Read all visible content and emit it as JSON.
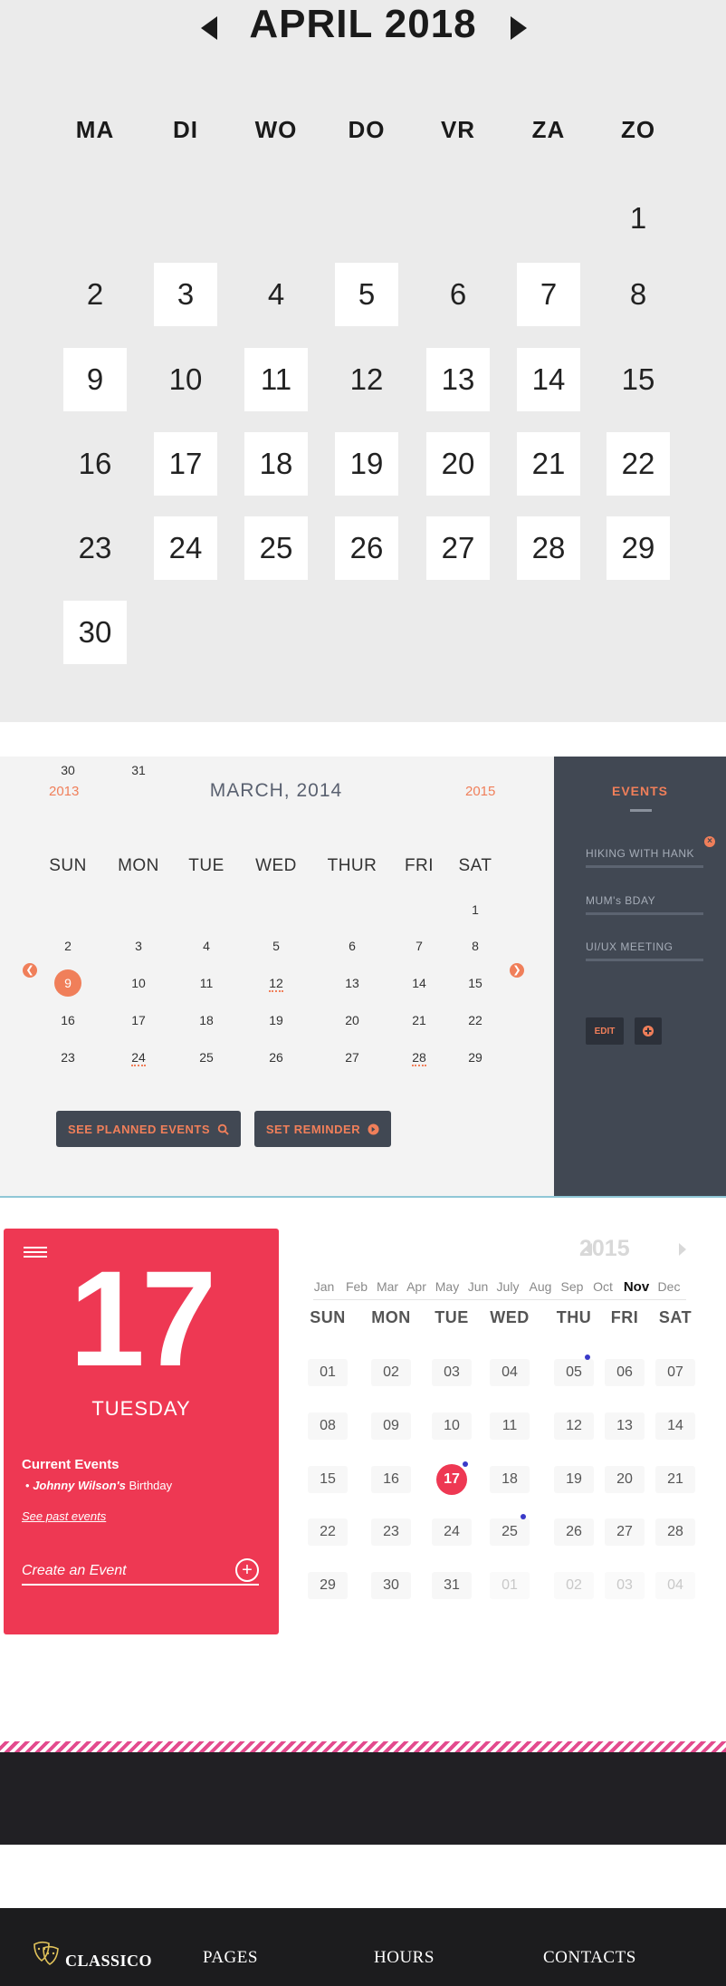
{
  "calendar_april": {
    "title": "APRIL 2018",
    "weekdays": [
      "MA",
      "DI",
      "WO",
      "DO",
      "VR",
      "ZA",
      "ZO"
    ],
    "days": [
      "1",
      "2",
      "3",
      "4",
      "5",
      "6",
      "7",
      "8",
      "9",
      "10",
      "11",
      "12",
      "13",
      "14",
      "15",
      "16",
      "17",
      "18",
      "19",
      "20",
      "21",
      "22",
      "23",
      "24",
      "25",
      "26",
      "27",
      "28",
      "29",
      "30"
    ],
    "highlighted_days": [
      3,
      5,
      7,
      9,
      11,
      13,
      14,
      17,
      18,
      19,
      20,
      21,
      22,
      24,
      25,
      26,
      27,
      28,
      29,
      30
    ]
  },
  "calendar_march": {
    "prev_year": "2013",
    "title": "MARCH, 2014",
    "next_year": "2015",
    "weekdays": [
      "SUN",
      "MON",
      "TUE",
      "WED",
      "THUR",
      "FRI",
      "SAT"
    ],
    "days": [
      "1",
      "2",
      "3",
      "4",
      "5",
      "6",
      "7",
      "8",
      "9",
      "10",
      "11",
      "12",
      "13",
      "14",
      "15",
      "16",
      "17",
      "18",
      "19",
      "20",
      "21",
      "22",
      "23",
      "24",
      "25",
      "26",
      "27",
      "28",
      "29",
      "30",
      "31"
    ],
    "selected_day": 9,
    "event_days": [
      12,
      24,
      28
    ],
    "see_planned_label": "SEE PLANNED EVENTS",
    "set_reminder_label": "SET REMINDER",
    "accent_color": "#f07f5a",
    "events_panel": {
      "title": "EVENTS",
      "items": [
        "HIKING WITH HANK",
        "MUM's BDAY",
        "UI/UX MEETING"
      ],
      "edit_label": "EDIT"
    }
  },
  "calendar_day": {
    "day_number": "17",
    "weekday": "TUESDAY",
    "current_events_title": "Current Events",
    "current_event_bullet": "•",
    "current_event_name": "Johnny Wilson's",
    "current_event_suffix": " Birthday",
    "past_events_link": "See past events",
    "create_placeholder": "Create an Event",
    "create_icon": "+",
    "year": "2015",
    "months": [
      "Jan",
      "Feb",
      "Mar",
      "Apr",
      "May",
      "Jun",
      "July",
      "Aug",
      "Sep",
      "Oct",
      "Nov",
      "Dec"
    ],
    "active_month": "Nov",
    "weekdays": [
      "SUN",
      "MON",
      "TUE",
      "WED",
      "THU",
      "FRI",
      "SAT"
    ],
    "days": [
      "01",
      "02",
      "03",
      "04",
      "05",
      "06",
      "07",
      "08",
      "09",
      "10",
      "11",
      "12",
      "13",
      "14",
      "15",
      "16",
      "17",
      "18",
      "19",
      "20",
      "21",
      "22",
      "23",
      "24",
      "25",
      "26",
      "27",
      "28",
      "29",
      "30",
      "31",
      "01",
      "02",
      "03",
      "04"
    ],
    "today_day": "17",
    "event_dot_days": [
      "05",
      "17",
      "25"
    ],
    "accent_color": "#ee3853"
  },
  "footer": {
    "brand": "CLASSICO",
    "links": [
      "PAGES",
      "HOURS",
      "CONTACTS"
    ]
  }
}
